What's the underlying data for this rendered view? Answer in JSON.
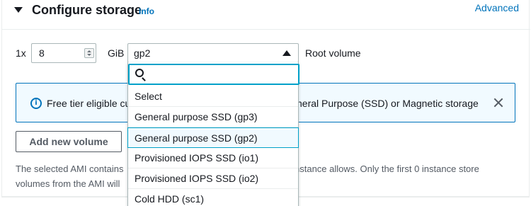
{
  "header": {
    "title": "Configure storage",
    "info_label": "Info",
    "advanced_label": "Advanced"
  },
  "storage_row": {
    "quantity_prefix": "1x",
    "size_value": "8",
    "size_unit": "GiB",
    "volume_type": "gp2",
    "root_label": "Root volume"
  },
  "alert": {
    "text_left": "Free tier eligible cu",
    "text_right": "neral Purpose (SSD) or Magnetic storage"
  },
  "add_volume_label": "Add new volume",
  "description": {
    "line1": "The selected AMI contains",
    "line2": "volumes from the AMI will",
    "line1_right": "nstance allows. Only the first 0 instance store"
  },
  "dropdown": {
    "search_placeholder": "",
    "options": [
      "Select",
      "General purpose SSD (gp3)",
      "General purpose SSD (gp2)",
      "Provisioned IOPS SSD (io1)",
      "Provisioned IOPS SSD (io2)",
      "Cold HDD (sc1)"
    ],
    "selected_index": 2
  },
  "colors": {
    "accent": "#0073bb",
    "focus": "#00a1c9",
    "alert_bg": "#f1faff"
  }
}
